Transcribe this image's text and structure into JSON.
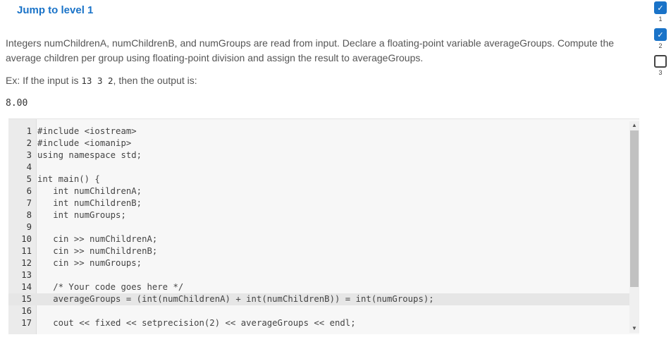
{
  "header": {
    "jump_label": "Jump to level 1"
  },
  "description": "Integers numChildrenA, numChildrenB, and numGroups are read from input. Declare a floating-point variable averageGroups. Compute the average children per group using floating-point division and assign the result to averageGroups.",
  "example": {
    "prefix": "Ex: If the input is ",
    "input": "13  3  2",
    "suffix": ", then the output is:",
    "output": "8.00"
  },
  "editor": {
    "active_line": 15,
    "lines": [
      "#include <iostream>",
      "#include <iomanip>",
      "using namespace std;",
      "",
      "int main() {",
      "   int numChildrenA;",
      "   int numChildrenB;",
      "   int numGroups;",
      "",
      "   cin >> numChildrenA;",
      "   cin >> numChildrenB;",
      "   cin >> numGroups;",
      "",
      "   /* Your code goes here */",
      "   averageGroups = (int(numChildrenA) + int(numChildrenB)) = int(numGroups);",
      "",
      "   cout << fixed << setprecision(2) << averageGroups << endl;"
    ]
  },
  "levels": [
    {
      "num": "1",
      "status": "done",
      "icon": "checkmark-icon"
    },
    {
      "num": "2",
      "status": "done",
      "icon": "checkmark-icon"
    },
    {
      "num": "3",
      "status": "todo",
      "icon": ""
    }
  ]
}
